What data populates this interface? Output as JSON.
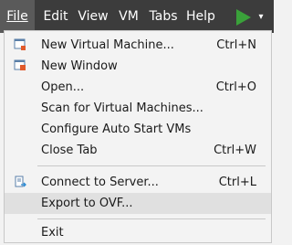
{
  "menubar": {
    "items": [
      {
        "label": "File",
        "underline_index": 0
      },
      {
        "label": "Edit",
        "underline_index": 0
      },
      {
        "label": "View",
        "underline_index": 0
      },
      {
        "label": "VM",
        "underline_index": 1
      },
      {
        "label": "Tabs",
        "underline_index": 0
      },
      {
        "label": "Help",
        "underline_index": 0
      }
    ],
    "active": "File",
    "play_button_icon": "play-icon",
    "play_dropdown_icon": "chevron-down-icon",
    "accent_color": "#3aa13a"
  },
  "file_menu": {
    "items": [
      {
        "label": "New Virtual Machine...",
        "shortcut": "Ctrl+N",
        "icon": "new-vm-icon"
      },
      {
        "label": "New Window",
        "shortcut": "",
        "icon": "new-window-icon"
      },
      {
        "label": "Open...",
        "shortcut": "Ctrl+O",
        "icon": ""
      },
      {
        "label": "Scan for Virtual Machines...",
        "shortcut": "",
        "icon": ""
      },
      {
        "label": "Configure Auto Start VMs",
        "shortcut": "",
        "icon": ""
      },
      {
        "label": "Close Tab",
        "shortcut": "Ctrl+W",
        "icon": ""
      },
      {
        "label": "Connect to Server...",
        "shortcut": "Ctrl+L",
        "icon": "connect-server-icon"
      },
      {
        "label": "Export to OVF...",
        "shortcut": "",
        "icon": ""
      },
      {
        "label": "Exit",
        "shortcut": "",
        "icon": ""
      }
    ],
    "hovered": "Export to OVF..."
  }
}
